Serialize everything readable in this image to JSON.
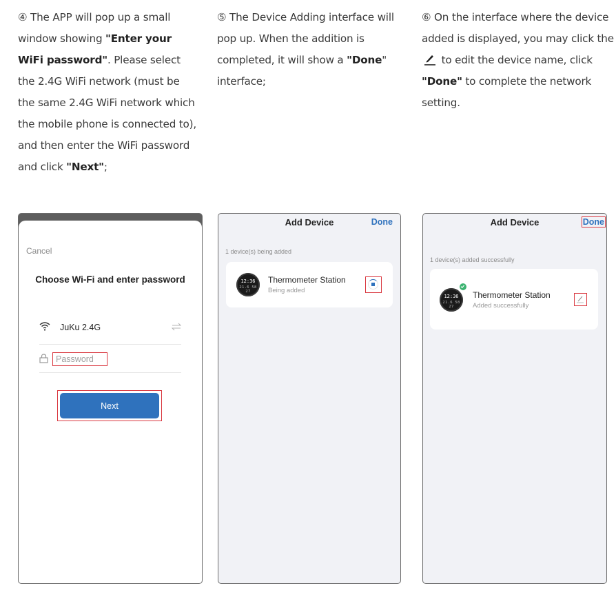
{
  "instructions": [
    {
      "marker": "④",
      "parts": [
        {
          "t": " The APP will pop up a small window showing ",
          "b": false
        },
        {
          "t": "\"Enter your WiFi password\"",
          "b": true
        },
        {
          "t": ". Please select the 2.4G WiFi network (must be the same 2.4G WiFi network which the mobile phone is connected to), and then enter the WiFi password and click ",
          "b": false
        },
        {
          "t": "\"Next\"",
          "b": true
        },
        {
          "t": ";",
          "b": false
        }
      ]
    },
    {
      "marker": "⑤",
      "parts": [
        {
          "t": " The Device Adding interface will pop up. When the addition is completed, it will show a ",
          "b": false
        },
        {
          "t": "\"Done",
          "b": true
        },
        {
          "t": "\" interface;",
          "b": false
        }
      ]
    },
    {
      "marker": "⑥",
      "before_icon": " On the interface where the device added is displayed, you may click the ",
      "icon": "pencil-icon",
      "after_icon_parts": [
        {
          "t": " to edit the device name, click ",
          "b": false
        },
        {
          "t": "\"Done\"",
          "b": true
        },
        {
          "t": " to complete the network setting.",
          "b": false
        }
      ]
    }
  ],
  "screen1": {
    "cancel_label": "Cancel",
    "title": "Choose Wi-Fi and enter password",
    "wifi_icon": "wifi-icon",
    "wifi_name": "JuKu 2.4G",
    "switch_icon": "switch-arrows-icon",
    "lock_icon": "lock-icon",
    "password_placeholder": "Password",
    "password_value": "",
    "next_label": "Next"
  },
  "screen2": {
    "title": "Add Device",
    "done_label": "Done",
    "status": "1 device(s) being added",
    "device": {
      "name": "Thermometer Station",
      "status": "Being added",
      "display_time": "12:36",
      "display_digits": "21.6 58 27"
    },
    "progress_icon": "loading-spinner-icon"
  },
  "screen3": {
    "title": "Add Device",
    "done_label": "Done",
    "status": "1 device(s) added successfully",
    "device": {
      "name": "Thermometer Station",
      "status": "Added successfully",
      "display_time": "12:36",
      "display_digits": "21.6 58 27"
    },
    "badge_icon": "check-icon",
    "edit_icon": "pencil-icon"
  },
  "colors": {
    "accent_blue": "#2f72bd",
    "highlight_red": "#d9363e",
    "success_green": "#3cb371",
    "screen_bg": "#f1f2f6"
  }
}
